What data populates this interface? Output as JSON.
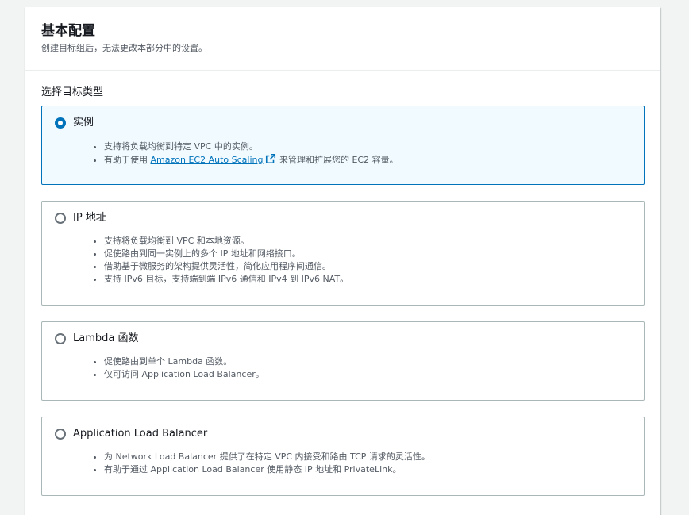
{
  "panel": {
    "title": "基本配置",
    "description": "创建目标组后，无法更改本部分中的设置。"
  },
  "target_type": {
    "label": "选择目标类型",
    "options": [
      {
        "label": "实例",
        "selected": true,
        "bullets": [
          "支持将负载均衡到特定 VPC 中的实例。"
        ],
        "link_bullet": {
          "prefix": "有助于使用 ",
          "link_text": "Amazon EC2 Auto Scaling",
          "suffix": " 来管理和扩展您的 EC2 容量。"
        }
      },
      {
        "label": "IP 地址",
        "selected": false,
        "bullets": [
          "支持将负载均衡到 VPC 和本地资源。",
          "促使路由到同一实例上的多个 IP 地址和网络接口。",
          "借助基于微服务的架构提供灵活性，简化应用程序间通信。",
          "支持 IPv6 目标，支持端到端 IPv6 通信和 IPv4 到 IPv6 NAT。"
        ]
      },
      {
        "label": "Lambda 函数",
        "selected": false,
        "bullets": [
          "促使路由到单个 Lambda 函数。",
          "仅可访问 Application Load Balancer。"
        ]
      },
      {
        "label": "Application Load Balancer",
        "selected": false,
        "bullets": [
          "为 Network Load Balancer 提供了在特定 VPC 内接受和路由 TCP 请求的灵活性。",
          "有助于通过 Application Load Balancer 使用静态 IP 地址和 PrivateLink。"
        ]
      }
    ]
  },
  "icons": {
    "external_link": "external-link-icon"
  },
  "colors": {
    "accent": "#0073bb",
    "selected_bg": "#f1faff",
    "border": "#aab7b8"
  }
}
